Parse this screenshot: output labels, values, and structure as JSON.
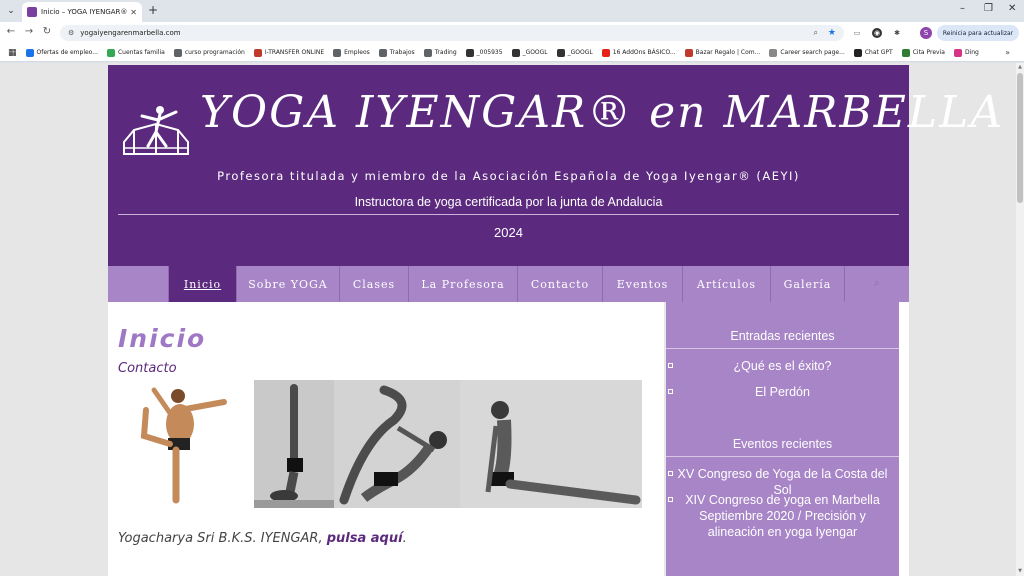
{
  "browser": {
    "tab_title": "Inicio – YOGA IYENGAR® en M",
    "url": "yogaiyengarenmarbella.com",
    "update_button": "Reinicia para actualizar",
    "profile_initial": "S",
    "bookmarks": [
      {
        "label": "Ofertas de empleo...",
        "color": "#1a73e8"
      },
      {
        "label": "Cuentas familia",
        "color": "#34a853"
      },
      {
        "label": "curso programación",
        "color": "#5f6368"
      },
      {
        "label": "I-TRANSFER ONLINE",
        "color": "#c0392b"
      },
      {
        "label": "Empleos",
        "color": "#5f6368"
      },
      {
        "label": "Trabajos",
        "color": "#5f6368"
      },
      {
        "label": "Trading",
        "color": "#5f6368"
      },
      {
        "label": "_005935",
        "color": "#333333"
      },
      {
        "label": "_GOOGL",
        "color": "#333333"
      },
      {
        "label": "_GOOGL",
        "color": "#333333"
      },
      {
        "label": "16 AddOns BÁSICO...",
        "color": "#e62117"
      },
      {
        "label": "Bazar Regalo | Com...",
        "color": "#c0392b"
      },
      {
        "label": "Career search page...",
        "color": "#888888"
      },
      {
        "label": "Chat GPT",
        "color": "#222222"
      },
      {
        "label": "Cita Previa",
        "color": "#2e7d32"
      },
      {
        "label": "Ding",
        "color": "#d63384"
      }
    ]
  },
  "header": {
    "title": "YOGA IYENGAR® en MARBELLA",
    "subtitle": "Profesora titulada y miembro de la Asociación Española de Yoga Iyengar® (AEYI)",
    "instructor": "Instructora de yoga certificada por la junta de Andalucia",
    "year": "2024"
  },
  "nav": {
    "items": [
      {
        "label": "Inicio",
        "active": true
      },
      {
        "label": "Sobre YOGA",
        "active": false
      },
      {
        "label": "Clases",
        "active": false
      },
      {
        "label": "La Profesora",
        "active": false
      },
      {
        "label": "Contacto",
        "active": false
      },
      {
        "label": "Eventos",
        "active": false
      },
      {
        "label": "Artículos",
        "active": false
      },
      {
        "label": "Galería",
        "active": false
      }
    ]
  },
  "content": {
    "page_title": "Inicio",
    "contact_link": "Contacto",
    "caption_text": "Yogacharya Sri B.K.S. IYENGAR,",
    "caption_link": "pulsa aquí",
    "caption_end": "."
  },
  "sidebar": {
    "recent_posts_title": "Entradas recientes",
    "recent_posts": [
      "¿Qué es el éxito?",
      "El Perdón"
    ],
    "recent_events_title": "Eventos recientes",
    "recent_events": [
      "XV Congreso de Yoga de la Costa del Sol",
      "XIV Congreso de yoga en Marbella Septiembre 2020 / Precisión y alineación en yoga Iyengar"
    ]
  },
  "colors": {
    "header_purple": "#5b2a7e",
    "nav_lilac": "#a785c7",
    "title_lilac": "#9e78c4"
  }
}
